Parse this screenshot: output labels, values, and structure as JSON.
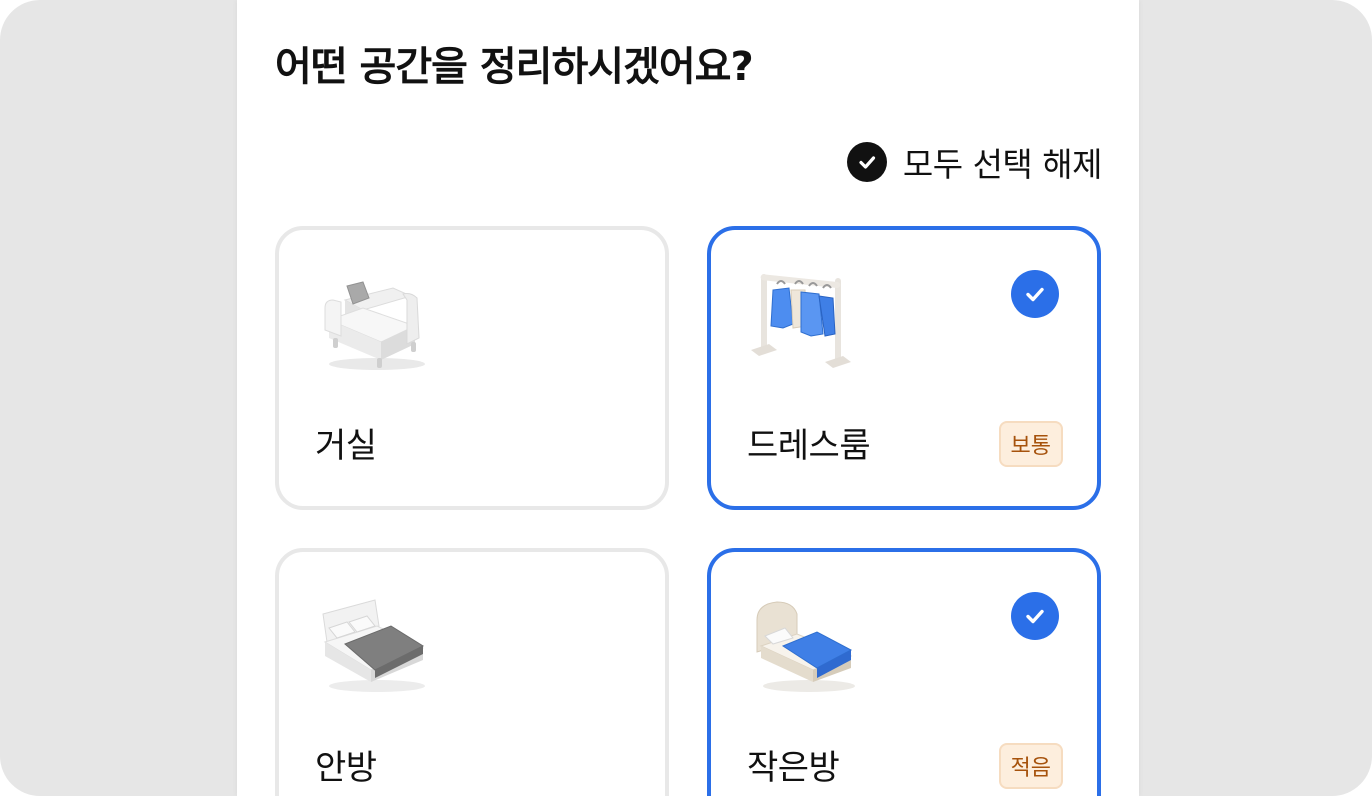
{
  "header": {
    "title": "어떤 공간을 정리하시겠어요?"
  },
  "deselect_all": {
    "label": "모두 선택 해제",
    "icon": "check-circle-icon"
  },
  "colors": {
    "accent": "#2b6fe8",
    "badge_bg": "#fdeedd",
    "badge_text": "#a6520c"
  },
  "rooms": [
    {
      "label": "거실",
      "icon": "sofa-icon",
      "selected": false,
      "badge": ""
    },
    {
      "label": "드레스룸",
      "icon": "clothes-rack-icon",
      "selected": true,
      "badge": "보통"
    },
    {
      "label": "안방",
      "icon": "double-bed-icon",
      "selected": false,
      "badge": ""
    },
    {
      "label": "작은방",
      "icon": "single-bed-icon",
      "selected": true,
      "badge": "적음"
    }
  ]
}
